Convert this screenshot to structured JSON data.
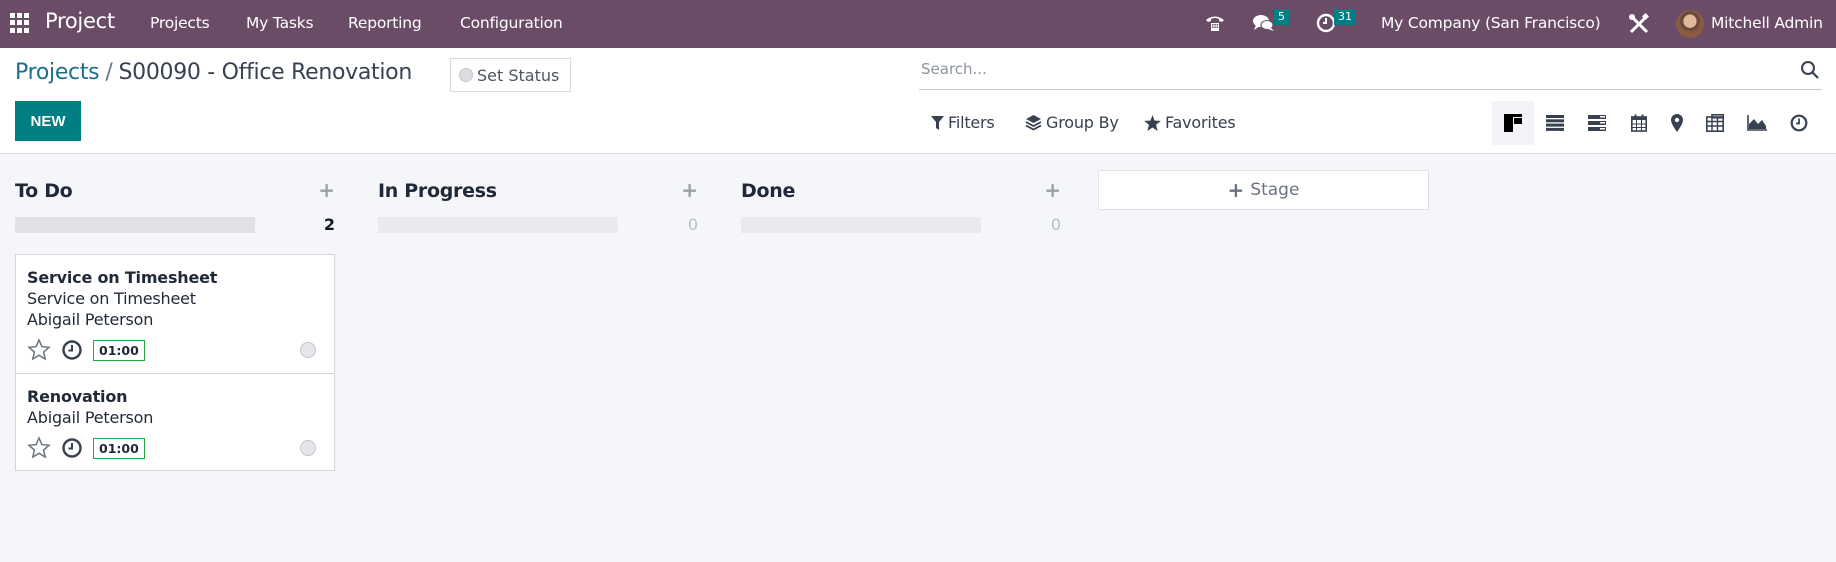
{
  "navbar": {
    "app_name": "Project",
    "menu": [
      "Projects",
      "My Tasks",
      "Reporting",
      "Configuration"
    ],
    "messages_count": "5",
    "activities_count": "31",
    "company": "My Company (San Francisco)",
    "user": "Mitchell Admin",
    "icons": [
      "apps-grid-icon",
      "phone-icon",
      "messages-icon",
      "activity-clock-icon",
      "tools-icon"
    ]
  },
  "control_panel": {
    "breadcrumb_parent": "Projects",
    "breadcrumb_separator": "/",
    "breadcrumb_current": "S00090 - Office Renovation",
    "set_status_label": "Set Status",
    "new_label": "NEW",
    "search_placeholder": "Search...",
    "filters_label": "Filters",
    "group_by_label": "Group By",
    "favorites_label": "Favorites",
    "views": [
      {
        "name": "kanban",
        "active": true
      },
      {
        "name": "list",
        "active": false
      },
      {
        "name": "activity",
        "active": false
      },
      {
        "name": "calendar",
        "active": false
      },
      {
        "name": "map",
        "active": false
      },
      {
        "name": "pivot",
        "active": false
      },
      {
        "name": "graph",
        "active": false
      },
      {
        "name": "timeline",
        "active": false
      }
    ]
  },
  "kanban": {
    "columns": [
      {
        "title": "To Do",
        "count": "2"
      },
      {
        "title": "In Progress",
        "count": "0"
      },
      {
        "title": "Done",
        "count": "0"
      }
    ],
    "add_column_symbol": "+",
    "add_stage_label": "Stage",
    "cards": [
      {
        "title": "Service on Timesheet",
        "lines": [
          "Service on Timesheet",
          "Abigail Peterson"
        ],
        "hours": "01:00"
      },
      {
        "title": "Renovation",
        "lines": [
          "Abigail Peterson"
        ],
        "hours": "01:00"
      }
    ]
  },
  "colors": {
    "navbar": "#6a4c67",
    "primary": "#017e84",
    "link": "#1f6f8b",
    "hours_border": "#28a745"
  }
}
